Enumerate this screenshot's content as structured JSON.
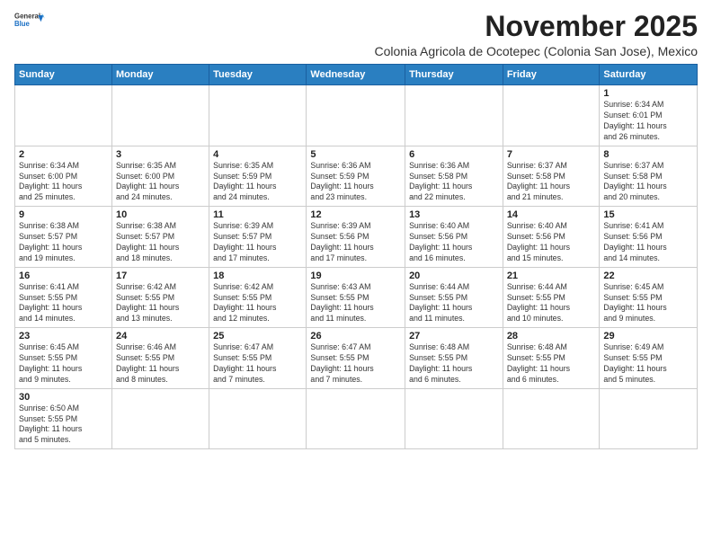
{
  "header": {
    "logo_line1": "General",
    "logo_line2": "Blue",
    "month_title": "November 2025",
    "location": "Colonia Agricola de Ocotepec (Colonia San Jose), Mexico"
  },
  "days_of_week": [
    "Sunday",
    "Monday",
    "Tuesday",
    "Wednesday",
    "Thursday",
    "Friday",
    "Saturday"
  ],
  "weeks": [
    [
      {
        "day": "",
        "info": ""
      },
      {
        "day": "",
        "info": ""
      },
      {
        "day": "",
        "info": ""
      },
      {
        "day": "",
        "info": ""
      },
      {
        "day": "",
        "info": ""
      },
      {
        "day": "",
        "info": ""
      },
      {
        "day": "1",
        "info": "Sunrise: 6:34 AM\nSunset: 6:01 PM\nDaylight: 11 hours\nand 26 minutes."
      }
    ],
    [
      {
        "day": "2",
        "info": "Sunrise: 6:34 AM\nSunset: 6:00 PM\nDaylight: 11 hours\nand 25 minutes."
      },
      {
        "day": "3",
        "info": "Sunrise: 6:35 AM\nSunset: 6:00 PM\nDaylight: 11 hours\nand 24 minutes."
      },
      {
        "day": "4",
        "info": "Sunrise: 6:35 AM\nSunset: 5:59 PM\nDaylight: 11 hours\nand 24 minutes."
      },
      {
        "day": "5",
        "info": "Sunrise: 6:36 AM\nSunset: 5:59 PM\nDaylight: 11 hours\nand 23 minutes."
      },
      {
        "day": "6",
        "info": "Sunrise: 6:36 AM\nSunset: 5:58 PM\nDaylight: 11 hours\nand 22 minutes."
      },
      {
        "day": "7",
        "info": "Sunrise: 6:37 AM\nSunset: 5:58 PM\nDaylight: 11 hours\nand 21 minutes."
      },
      {
        "day": "8",
        "info": "Sunrise: 6:37 AM\nSunset: 5:58 PM\nDaylight: 11 hours\nand 20 minutes."
      }
    ],
    [
      {
        "day": "9",
        "info": "Sunrise: 6:38 AM\nSunset: 5:57 PM\nDaylight: 11 hours\nand 19 minutes."
      },
      {
        "day": "10",
        "info": "Sunrise: 6:38 AM\nSunset: 5:57 PM\nDaylight: 11 hours\nand 18 minutes."
      },
      {
        "day": "11",
        "info": "Sunrise: 6:39 AM\nSunset: 5:57 PM\nDaylight: 11 hours\nand 17 minutes."
      },
      {
        "day": "12",
        "info": "Sunrise: 6:39 AM\nSunset: 5:56 PM\nDaylight: 11 hours\nand 17 minutes."
      },
      {
        "day": "13",
        "info": "Sunrise: 6:40 AM\nSunset: 5:56 PM\nDaylight: 11 hours\nand 16 minutes."
      },
      {
        "day": "14",
        "info": "Sunrise: 6:40 AM\nSunset: 5:56 PM\nDaylight: 11 hours\nand 15 minutes."
      },
      {
        "day": "15",
        "info": "Sunrise: 6:41 AM\nSunset: 5:56 PM\nDaylight: 11 hours\nand 14 minutes."
      }
    ],
    [
      {
        "day": "16",
        "info": "Sunrise: 6:41 AM\nSunset: 5:55 PM\nDaylight: 11 hours\nand 14 minutes."
      },
      {
        "day": "17",
        "info": "Sunrise: 6:42 AM\nSunset: 5:55 PM\nDaylight: 11 hours\nand 13 minutes."
      },
      {
        "day": "18",
        "info": "Sunrise: 6:42 AM\nSunset: 5:55 PM\nDaylight: 11 hours\nand 12 minutes."
      },
      {
        "day": "19",
        "info": "Sunrise: 6:43 AM\nSunset: 5:55 PM\nDaylight: 11 hours\nand 11 minutes."
      },
      {
        "day": "20",
        "info": "Sunrise: 6:44 AM\nSunset: 5:55 PM\nDaylight: 11 hours\nand 11 minutes."
      },
      {
        "day": "21",
        "info": "Sunrise: 6:44 AM\nSunset: 5:55 PM\nDaylight: 11 hours\nand 10 minutes."
      },
      {
        "day": "22",
        "info": "Sunrise: 6:45 AM\nSunset: 5:55 PM\nDaylight: 11 hours\nand 9 minutes."
      }
    ],
    [
      {
        "day": "23",
        "info": "Sunrise: 6:45 AM\nSunset: 5:55 PM\nDaylight: 11 hours\nand 9 minutes."
      },
      {
        "day": "24",
        "info": "Sunrise: 6:46 AM\nSunset: 5:55 PM\nDaylight: 11 hours\nand 8 minutes."
      },
      {
        "day": "25",
        "info": "Sunrise: 6:47 AM\nSunset: 5:55 PM\nDaylight: 11 hours\nand 7 minutes."
      },
      {
        "day": "26",
        "info": "Sunrise: 6:47 AM\nSunset: 5:55 PM\nDaylight: 11 hours\nand 7 minutes."
      },
      {
        "day": "27",
        "info": "Sunrise: 6:48 AM\nSunset: 5:55 PM\nDaylight: 11 hours\nand 6 minutes."
      },
      {
        "day": "28",
        "info": "Sunrise: 6:48 AM\nSunset: 5:55 PM\nDaylight: 11 hours\nand 6 minutes."
      },
      {
        "day": "29",
        "info": "Sunrise: 6:49 AM\nSunset: 5:55 PM\nDaylight: 11 hours\nand 5 minutes."
      }
    ],
    [
      {
        "day": "30",
        "info": "Sunrise: 6:50 AM\nSunset: 5:55 PM\nDaylight: 11 hours\nand 5 minutes."
      },
      {
        "day": "",
        "info": ""
      },
      {
        "day": "",
        "info": ""
      },
      {
        "day": "",
        "info": ""
      },
      {
        "day": "",
        "info": ""
      },
      {
        "day": "",
        "info": ""
      },
      {
        "day": "",
        "info": ""
      }
    ]
  ]
}
